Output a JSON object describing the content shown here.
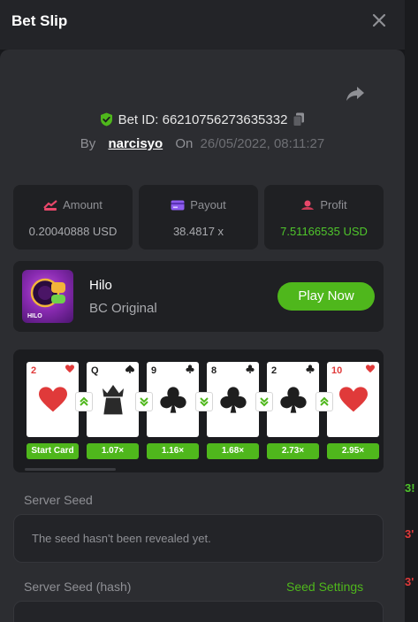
{
  "header": {
    "title": "Bet Slip"
  },
  "bet": {
    "id_text": "Bet ID: 66210756273635332",
    "by_label": "By",
    "username": "narcisyo",
    "on_label": "On",
    "date": "26/05/2022, 08:11:27"
  },
  "stats": {
    "amount": {
      "label": "Amount",
      "value": "0.20040888 USD"
    },
    "payout": {
      "label": "Payout",
      "value": "38.4817 x"
    },
    "profit": {
      "label": "Profit",
      "value": "7.51166535 USD"
    }
  },
  "game": {
    "name": "Hilo",
    "provider": "BC Original",
    "thumb_text": "HILO",
    "play_label": "Play Now"
  },
  "cards": [
    {
      "rank": "2",
      "suit": "hearts",
      "color": "#e03a3a",
      "multiplier": "Start Card",
      "arrow": ""
    },
    {
      "rank": "Q",
      "suit": "spades",
      "color": "#1e1e1e",
      "multiplier": "1.07×",
      "arrow": "up"
    },
    {
      "rank": "9",
      "suit": "clubs",
      "color": "#1e1e1e",
      "multiplier": "1.16×",
      "arrow": "down"
    },
    {
      "rank": "8",
      "suit": "clubs",
      "color": "#1e1e1e",
      "multiplier": "1.68×",
      "arrow": "down"
    },
    {
      "rank": "2",
      "suit": "clubs",
      "color": "#1e1e1e",
      "multiplier": "2.73×",
      "arrow": "down"
    },
    {
      "rank": "10",
      "suit": "hearts",
      "color": "#e03a3a",
      "multiplier": "2.95×",
      "arrow": "up"
    }
  ],
  "seed": {
    "server_seed_label": "Server Seed",
    "server_seed_value": "The seed hasn't been revealed yet.",
    "hash_label": "Server Seed (hash)",
    "settings_label": "Seed Settings"
  },
  "background_fragments": [
    {
      "text": "3!",
      "color": "#4fc52b"
    },
    {
      "text": "3'",
      "color": "#e03a3a"
    },
    {
      "text": "3'",
      "color": "#e03a3a"
    }
  ],
  "colors": {
    "accent_green": "#4fb71c",
    "profit_green": "#4fc52b",
    "panel": "#2c2d31",
    "card_bg": "#1f2023"
  },
  "icons": {
    "close": "close-icon",
    "share": "share-icon",
    "shield": "shield-check-icon",
    "copy": "copy-icon",
    "amount": "coins-icon",
    "payout": "card-icon",
    "profit": "profit-icon"
  }
}
